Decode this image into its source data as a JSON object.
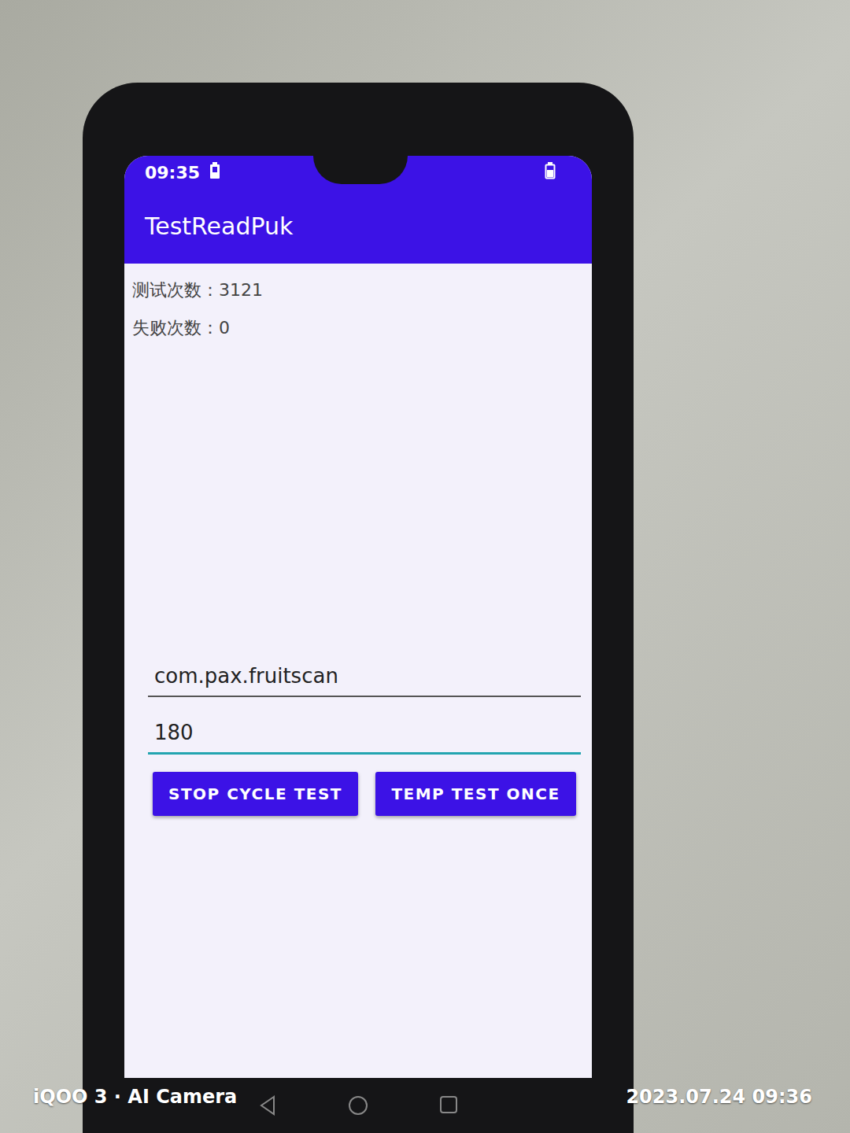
{
  "status_bar": {
    "time": "09:35"
  },
  "app_bar": {
    "title": "TestReadPuk"
  },
  "stats": [
    {
      "label": "测试次数：",
      "value": "3121"
    },
    {
      "label": "失败次数：",
      "value": "0"
    }
  ],
  "fields": [
    {
      "value": "com.pax.fruitscan",
      "focused": false
    },
    {
      "value": "180",
      "focused": true
    }
  ],
  "buttons": [
    "STOP CYCLE TEST",
    "TEMP TEST ONCE"
  ],
  "watermark": {
    "camera": "iQOO 3 · AI Camera",
    "datetime": "2023.07.24 09:36"
  }
}
